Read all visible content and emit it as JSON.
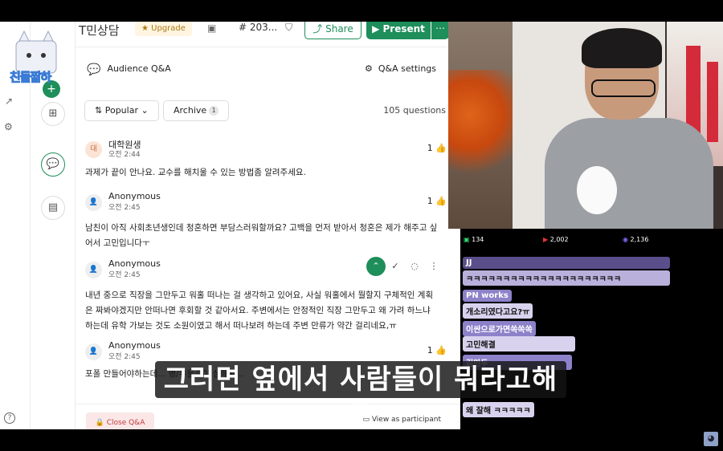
{
  "app": {
    "title": "무엇이든 T민상담",
    "upgrade": "Upgrade",
    "hash": "#  203...",
    "share": "Share",
    "present": "Present",
    "more": "⋯",
    "back": "←"
  },
  "logo": {
    "label": "친돌짧하"
  },
  "section": {
    "title": "Audience Q&A",
    "settings": "Q&A settings",
    "sort": "Popular",
    "archive": "Archive",
    "archive_count": "1",
    "count": "105 questions"
  },
  "questions": [
    {
      "avatar": "대",
      "name": "대학원생",
      "time": "오전 2:44",
      "likes": "1",
      "text": "과제가 끝이 안나요. 교수를 해치울 수 있는 방법좀 알려주세요."
    },
    {
      "avatar": "",
      "name": "Anonymous",
      "time": "오전 2:45",
      "likes": "1",
      "text": "남친이 아직 사회초년생인데 청혼하면 부담스러워할까요? 고백을 먼저 받아서 청혼은 제가 해주고 싶어서 고민입니다ㅜ"
    },
    {
      "avatar": "",
      "name": "Anonymous",
      "time": "오전 2:45",
      "likes": "",
      "text": "내년 중으로 직장을 그만두고 워홀 떠나는 걸 생각하고 있어요, 사실 워홀에서 뭘할지 구체적인 계획은 짜봐야겠지만 안떠나면 후회할 것 같아서요. 주변에서는 안정적인 직장 그만두고 왜 가려 하느냐 하는데 유학 가보는 것도 소원이였고 해서 떠나보려 하는데 주변 만류가 약간 걸리네요,ㅠ"
    },
    {
      "avatar": "",
      "name": "Anonymous",
      "time": "오전 2:45",
      "likes": "1",
      "text": "포폴 만들어야하는데... 병/우울증이 심해져..."
    }
  ],
  "footer": {
    "close": "Close Q&A",
    "view": "View as participant"
  },
  "stats": {
    "viewers_a": "134",
    "viewers_b": "2,002",
    "viewers_c": "2,136"
  },
  "chat": [
    {
      "name": "JJ",
      "msg": "ㅋㅋㅋㅋㅋㅋㅋㅋㅋㅋㅋㅋㅋㅋㅋㅋㅋㅋㅋㅋㅋ"
    },
    {
      "name": "PN works",
      "msg": "개소리였다고요?ㅠ"
    },
    {
      "name": "이싼으로가면쏙쏙쏙",
      "msg": "고민해결"
    },
    {
      "name": "김만두",
      "msg": "왜 잘해 ㅋㅋㅋㅋㅋ"
    }
  ],
  "subtitle": "그러면 옆에서 사람들이 뭐라고해도",
  "colors": {
    "green": "#1e8e5a",
    "red": "#c23b3b"
  }
}
